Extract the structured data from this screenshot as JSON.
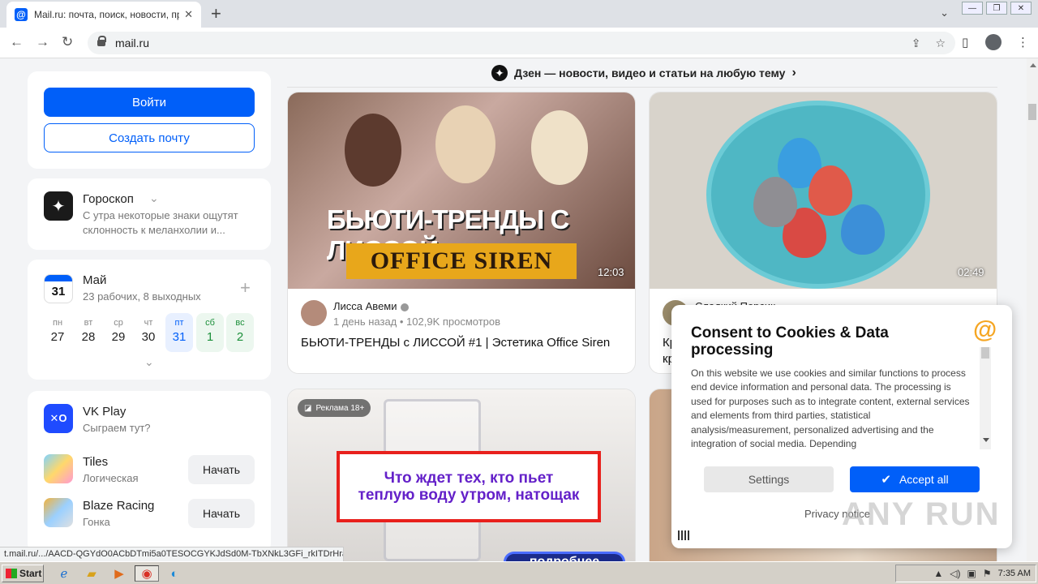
{
  "browser": {
    "tab_title": "Mail.ru: почта, поиск, новости, пр",
    "tab_favicon": "@",
    "new_tab": "+",
    "url": "mail.ru",
    "status_url": "t.mail.ru/.../AACD-QGYdO0ACbDTmi5a0TESOCGYKJdSd0M-TbXNkL3GFi_rkITDrHraC..."
  },
  "auth": {
    "login_label": "Войти",
    "create_label": "Создать почту"
  },
  "horoscope": {
    "title": "Гороскоп",
    "text_line1": "С утра некоторые знаки ощутят",
    "text_line2": "склонность к меланхолии и..."
  },
  "calendar": {
    "icon_day": "31",
    "month": "Май",
    "summary": "23 рабочих, 8 выходных",
    "plus": "+",
    "days": [
      {
        "name": "пн",
        "num": "27"
      },
      {
        "name": "вт",
        "num": "28"
      },
      {
        "name": "ср",
        "num": "29"
      },
      {
        "name": "чт",
        "num": "30"
      },
      {
        "name": "пт",
        "num": "31"
      },
      {
        "name": "сб",
        "num": "1"
      },
      {
        "name": "вс",
        "num": "2"
      }
    ]
  },
  "games": {
    "vkplay_title": "VK Play",
    "vkplay_sub": "Сыграем тут?",
    "items": [
      {
        "title": "Tiles",
        "sub": "Логическая",
        "action": "Начать"
      },
      {
        "title": "Blaze Racing",
        "sub": "Гонка",
        "action": "Начать"
      }
    ]
  },
  "dzen": {
    "headline": "Дзен — новости, видео и статьи на любую тему",
    "arrow": "›"
  },
  "feed": [
    {
      "thumb_title": "БЬЮТИ-ТРЕНДЫ С ЛИССОЙ",
      "thumb_banner": "OFFICE SIREN",
      "duration": "12:03",
      "author": "Лисса Авеми",
      "meta": "1 день назад • 102,9K просмотров",
      "title": "БЬЮТИ-ТРЕНДЫ с ЛИССОЙ #1 | Эстетика Office Siren"
    },
    {
      "duration": "02:49",
      "author": "Сладкий Персик",
      "title_fragment": "Кр",
      "title_fragment2": "кр"
    }
  ],
  "ad": {
    "badge": "Реклама 18+",
    "line1": "Что ждет тех, кто пьет",
    "line2": "теплую воду утром, натощак",
    "more": "подробнее"
  },
  "consent": {
    "title": "Consent to Cookies & Data processing",
    "text": "On this website we use cookies and similar functions to process end device information and personal data. The processing is used for purposes such as to integrate content, external services and elements from third parties, statistical analysis/measurement, personalized advertising and the integration of social media. Depending",
    "settings_label": "Settings",
    "accept_label": "Accept all",
    "privacy_label": "Privacy notice"
  },
  "taskbar": {
    "start_label": "Start",
    "clock": "7:35 AM"
  },
  "watermark": "ANY RUN"
}
